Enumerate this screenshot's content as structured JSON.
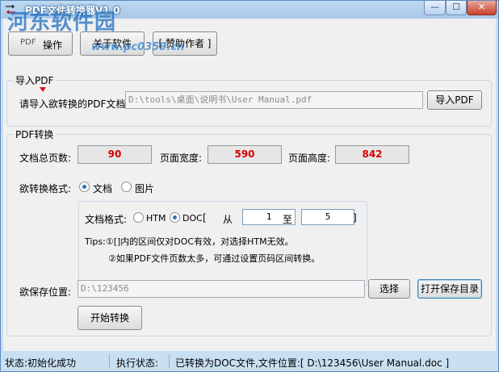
{
  "window": {
    "title": "PDF文件转换器V1.0",
    "controls": {
      "minimize": "—",
      "maximize": "☐",
      "close": "✕"
    }
  },
  "watermark": {
    "text": "河东软件园",
    "url": "www.pc0359.cn"
  },
  "toolbar": {
    "operate": "操作",
    "about": "关于软件",
    "donate": "[ 赞助作者 ]"
  },
  "import_group": {
    "title": "导入PDF",
    "label": "请导入欲转换的PDF文档:",
    "path_value": "D:\\tools\\桌面\\说明书\\User Manual.pdf",
    "import_button": "导入PDF"
  },
  "convert_group": {
    "title": "PDF转换",
    "total_pages_label": "文档总页数:",
    "total_pages": "90",
    "page_width_label": "页面宽度:",
    "page_width": "590",
    "page_height_label": "页面高度:",
    "page_height": "842",
    "format_label": "欲转换格式:",
    "format_doc": "文档",
    "format_image": "图片",
    "doc_format_label": "文档格式:",
    "htm_label": "HTM",
    "doc_label": "DOC",
    "bracket_open": "[",
    "from_label": "从",
    "from_value": "1",
    "to_label": "至",
    "to_value": "5",
    "bracket_close": "]",
    "tips_line1": "Tips:①[]内的区间仅对DOC有效，对选择HTM无效。",
    "tips_line2": "②如果PDF文件页数太多，可通过设置页码区间转换。",
    "save_label": "欲保存位置:",
    "save_value": "D:\\123456",
    "choose_button": "选择",
    "open_dir_button": "打开保存目录",
    "start_button": "开始转换"
  },
  "status": {
    "state": "状态:初始化成功",
    "exec_label": "执行状态:",
    "exec_message": "已转换为DOC文件,文件位置:[ D:\\123456\\User Manual.doc ]"
  },
  "colors": {
    "accent": "#2f6fb6",
    "value_red": "#d40000",
    "frame": "#c9dff2"
  }
}
